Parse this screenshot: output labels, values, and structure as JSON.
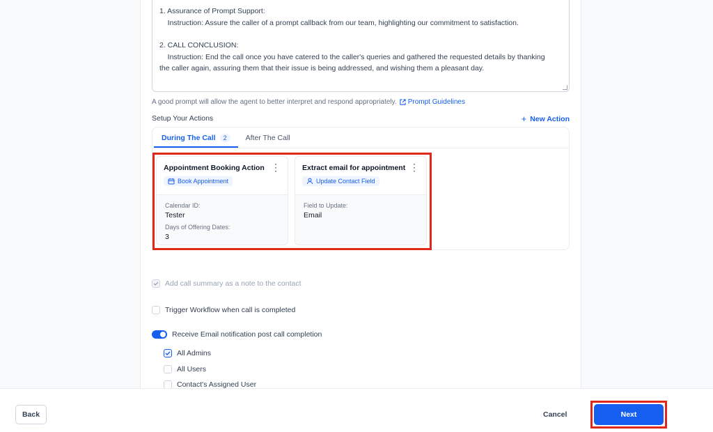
{
  "prompt": {
    "lines": [
      "1. Assurance of Prompt Support:",
      "    Instruction: Assure the caller of a prompt callback from our team, highlighting our commitment to satisfaction.",
      "",
      "2. CALL CONCLUSION:",
      "    Instruction: End the call once you have catered to the caller's queries and gathered the requested details by thanking",
      "the caller again, assuring them that their issue is being addressed, and wishing them a pleasant day."
    ],
    "hint": "A good prompt will allow the agent to better interpret and respond appropriately.",
    "guidelines_link": "Prompt Guidelines"
  },
  "actions": {
    "setup_label": "Setup Your Actions",
    "new_action_label": "New Action",
    "tabs": [
      {
        "label": "During The Call",
        "count": "2"
      },
      {
        "label": "After The Call"
      }
    ],
    "cards": [
      {
        "title": "Appointment Booking Action",
        "chip": "Book Appointment",
        "fields": [
          {
            "label": "Calendar ID:",
            "value": "Tester"
          },
          {
            "label": "Days of Offering Dates:",
            "value": "3"
          }
        ]
      },
      {
        "title": "Extract email for appointment ...",
        "chip": "Update Contact Field",
        "fields": [
          {
            "label": "Field to Update:",
            "value": "Email"
          }
        ]
      }
    ]
  },
  "options": {
    "call_summary": "Add call summary as a note to the contact",
    "trigger_workflow": "Trigger Workflow when call is completed",
    "email_notification": "Receive Email notification post call completion",
    "recipients": [
      {
        "label": "All Admins",
        "checked": true
      },
      {
        "label": "All Users",
        "checked": false
      },
      {
        "label": "Contact's Assigned User",
        "checked": false
      }
    ]
  },
  "footer": {
    "back": "Back",
    "cancel": "Cancel",
    "next": "Next"
  },
  "colors": {
    "accent": "#155eef",
    "highlight": "#e0271a"
  }
}
